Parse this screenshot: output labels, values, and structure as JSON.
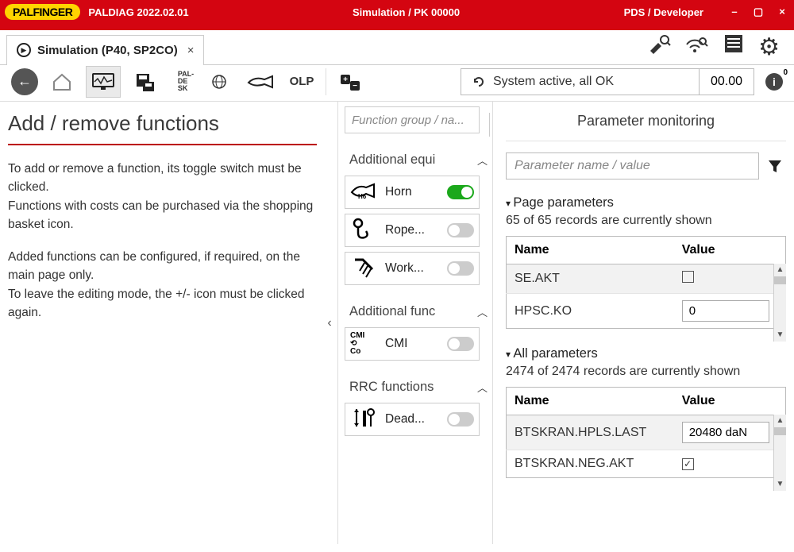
{
  "titlebar": {
    "brand": "PALFINGER",
    "app": "PALDIAG 2022.02.01",
    "center": "Simulation / PK 00000",
    "right": "PDS / Developer"
  },
  "tab": {
    "title": "Simulation (P40, SP2CO)"
  },
  "toolbar": {
    "olp": "OLP",
    "paldesk": "PAL-\nDE\nSK",
    "status_text": "System active, all OK",
    "status_value": "00.00",
    "info_badge": "0"
  },
  "left": {
    "title": "Add / remove functions",
    "para1": "To add or remove a function, its toggle switch must be clicked.\nFunctions with costs can be purchased via the shopping basket icon.",
    "para2": "Added functions can be configured, if required, on the main page only.\nTo leave the editing mode, the +/- icon must be clicked again."
  },
  "mid": {
    "search_placeholder": "Function group / na...",
    "groups": [
      {
        "title": "Additional equi",
        "items": [
          {
            "label": "Horn",
            "on": true,
            "icon": "horn"
          },
          {
            "label": "Rope...",
            "on": false,
            "icon": "rope"
          },
          {
            "label": "Work...",
            "on": false,
            "icon": "work"
          }
        ]
      },
      {
        "title": "Additional func",
        "items": [
          {
            "label": "CMI",
            "on": false,
            "icon": "cmi"
          }
        ]
      },
      {
        "title": "RRC functions",
        "items": [
          {
            "label": "Dead...",
            "on": false,
            "icon": "dead"
          }
        ]
      }
    ]
  },
  "right": {
    "title": "Parameter monitoring",
    "search_placeholder": "Parameter name / value",
    "page_section": "Page parameters",
    "page_records": "65 of 65 records are currently shown",
    "all_section": "All parameters",
    "all_records": "2474 of 2474 records are currently shown",
    "headers": {
      "name": "Name",
      "value": "Value"
    },
    "page_rows": [
      {
        "name": "SE.AKT",
        "value_type": "check",
        "value": false
      },
      {
        "name": "HPSC.KO",
        "value_type": "input",
        "value": "0"
      }
    ],
    "all_rows": [
      {
        "name": "BTSKRAN.HPLS.LAST",
        "value_type": "input",
        "value": "20480 daN"
      },
      {
        "name": "BTSKRAN.NEG.AKT",
        "value_type": "check",
        "value": true
      }
    ]
  }
}
